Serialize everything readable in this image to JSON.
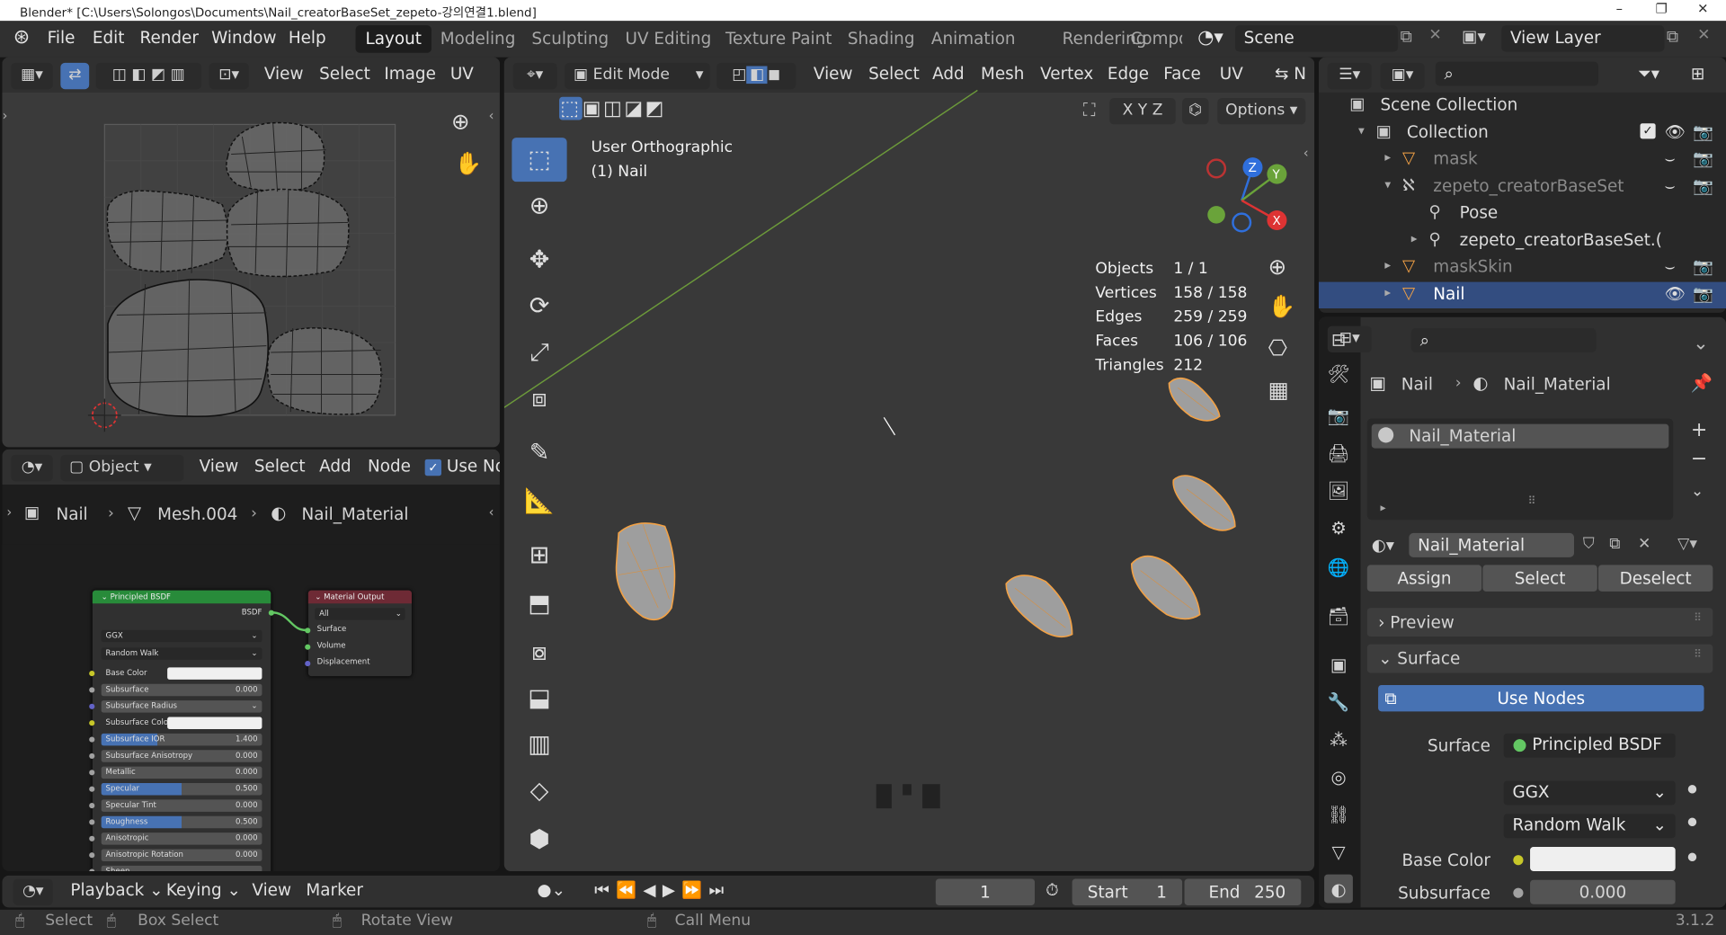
{
  "window": {
    "title": "Blender* [C:\\Users\\Solongos\\Documents\\Nail_creatorBaseSet_zepeto-강의연결1.blend]",
    "controls": [
      "–",
      "❐",
      "✕"
    ]
  },
  "menubar": {
    "items": [
      "File",
      "Edit",
      "Render",
      "Window",
      "Help"
    ],
    "workspaces": [
      "Layout",
      "Modeling",
      "Sculpting",
      "UV Editing",
      "Texture Paint",
      "Shading",
      "Animation",
      "Rendering",
      "Compo"
    ],
    "active_workspace": "Layout",
    "scene": "Scene",
    "view_layer": "View Layer"
  },
  "uv_editor": {
    "menus": [
      "View",
      "Select",
      "Image",
      "UV"
    ]
  },
  "node_editor": {
    "type": "Object",
    "menus": [
      "View",
      "Select",
      "Add",
      "Node"
    ],
    "use_nodes_label": "Use No",
    "breadcrumb": [
      "Nail",
      "Mesh.004",
      "Nail_Material"
    ],
    "bsdf": {
      "title": "Principled BSDF",
      "output_label": "BSDF",
      "distribution": "GGX",
      "subsurface_method": "Random Walk",
      "rows": [
        {
          "label": "Base Color",
          "value": "",
          "kind": "color",
          "sock": "#c7c729"
        },
        {
          "label": "Subsurface",
          "value": "0.000",
          "kind": "num",
          "sock": "#a1a1a1"
        },
        {
          "label": "Subsurface Radius",
          "value": "",
          "kind": "menu",
          "sock": "#6363c7"
        },
        {
          "label": "Subsurface Color",
          "value": "",
          "kind": "color",
          "sock": "#c7c729"
        },
        {
          "label": "Subsurface IOR",
          "value": "1.400",
          "kind": "num",
          "sock": "#a1a1a1",
          "fill": 0.35
        },
        {
          "label": "Subsurface Anisotropy",
          "value": "0.000",
          "kind": "num",
          "sock": "#a1a1a1"
        },
        {
          "label": "Metallic",
          "value": "0.000",
          "kind": "num",
          "sock": "#a1a1a1"
        },
        {
          "label": "Specular",
          "value": "0.500",
          "kind": "num",
          "sock": "#a1a1a1",
          "fill": 0.5
        },
        {
          "label": "Specular Tint",
          "value": "0.000",
          "kind": "num",
          "sock": "#a1a1a1"
        },
        {
          "label": "Roughness",
          "value": "0.500",
          "kind": "num",
          "sock": "#a1a1a1",
          "fill": 0.5
        },
        {
          "label": "Anisotropic",
          "value": "0.000",
          "kind": "num",
          "sock": "#a1a1a1"
        },
        {
          "label": "Anisotropic Rotation",
          "value": "0.000",
          "kind": "num",
          "sock": "#a1a1a1"
        },
        {
          "label": "Sheen",
          "value": "",
          "kind": "num",
          "sock": "#a1a1a1"
        }
      ]
    },
    "output": {
      "title": "Material Output",
      "target": "All",
      "inputs": [
        "Surface",
        "Volume",
        "Displacement"
      ]
    }
  },
  "viewport": {
    "mode": "Edit Mode",
    "menus": [
      "View",
      "Select",
      "Add",
      "Mesh",
      "Vertex",
      "Edge",
      "Face",
      "UV"
    ],
    "view_name": "User Orthographic",
    "object_label": "(1) Nail",
    "stats": [
      {
        "label": "Objects",
        "value": "1 / 1"
      },
      {
        "label": "Vertices",
        "value": "158 / 158"
      },
      {
        "label": "Edges",
        "value": "259 / 259"
      },
      {
        "label": "Faces",
        "value": "106 / 106"
      },
      {
        "label": "Triangles",
        "value": "212"
      }
    ],
    "options_label": "Options",
    "axes": {
      "x": "X",
      "y": "Y",
      "z": "Z"
    }
  },
  "outliner": {
    "search_placeholder": "",
    "items": [
      {
        "label": "Scene Collection",
        "level": 0
      },
      {
        "label": "Collection",
        "level": 1
      },
      {
        "label": "mask",
        "level": 2,
        "dim": true
      },
      {
        "label": "zepeto_creatorBaseSet",
        "level": 2,
        "dim": true
      },
      {
        "label": "Pose",
        "level": 3
      },
      {
        "label": "zepeto_creatorBaseSet.(",
        "level": 3
      },
      {
        "label": "maskSkin",
        "level": 2,
        "dim": true
      },
      {
        "label": "Nail",
        "level": 2,
        "selected": true
      }
    ]
  },
  "properties": {
    "breadcrumb": [
      "Nail",
      "Nail_Material"
    ],
    "slot": "Nail_Material",
    "material_name": "Nail_Material",
    "buttons": [
      "Assign",
      "Select",
      "Deselect"
    ],
    "panels": {
      "preview": "Preview",
      "surface": "Surface"
    },
    "use_nodes": "Use Nodes",
    "surface_label": "Surface",
    "surface_value": "Principled BSDF",
    "distribution": "GGX",
    "subsurface_method": "Random Walk",
    "base_color_label": "Base Color",
    "subsurface_label": "Subsurface",
    "subsurface_value": "0.000"
  },
  "timeline": {
    "menus": [
      "Playback",
      "Keying",
      "View",
      "Marker"
    ],
    "current_frame": "1",
    "start_label": "Start",
    "start": "1",
    "end_label": "End",
    "end": "250"
  },
  "statusbar": {
    "items": [
      "Select",
      "Box Select",
      "Rotate View",
      "Call Menu"
    ],
    "version": "3.1.2"
  },
  "colors": {
    "accent": "#4772b3",
    "header": "#303030",
    "editor_bg": "#3a3a3a",
    "selected_orange": "#f2a145"
  }
}
